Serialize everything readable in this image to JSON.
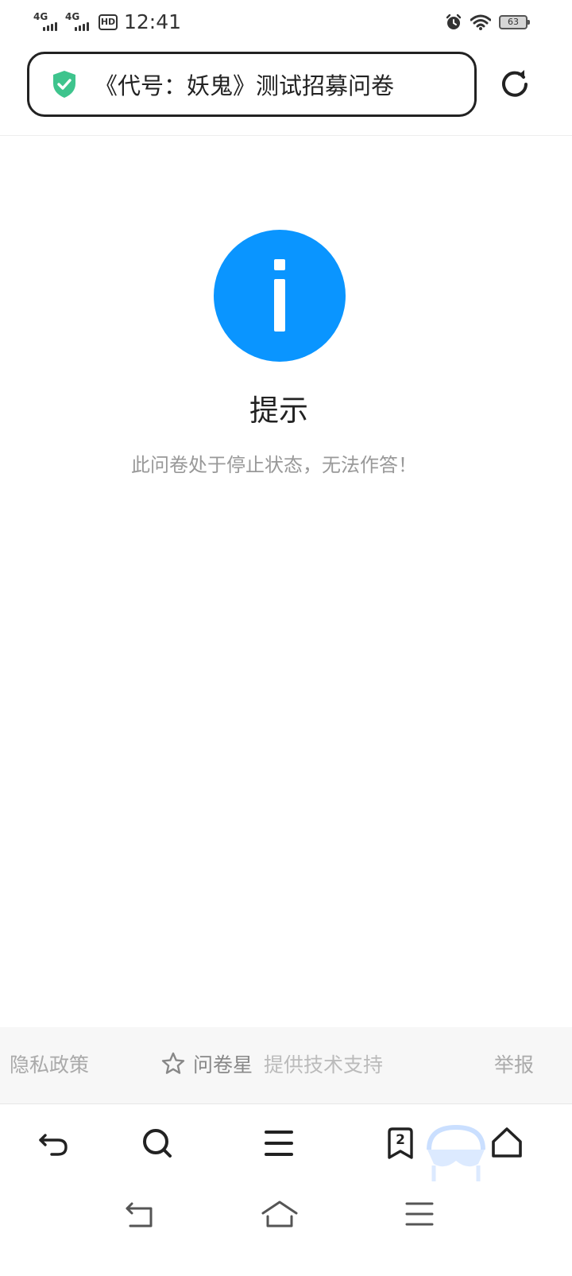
{
  "status_bar": {
    "network_1": "4G",
    "network_2": "4G",
    "hd_label": "HD",
    "time": "12:41",
    "battery_level": "63",
    "icons": [
      "alarm-icon",
      "wifi-icon",
      "battery-icon"
    ]
  },
  "address_bar": {
    "title": "《代号：妖鬼》测试招募问卷",
    "security_icon": "shield-check-icon",
    "reload_icon": "reload-icon"
  },
  "message": {
    "icon": "info-icon",
    "title": "提示",
    "text": "此问卷处于停止状态，无法作答！"
  },
  "footer": {
    "privacy": "隐私政策",
    "brand_name": "问卷星",
    "brand_support": "提供技术支持",
    "report": "举报"
  },
  "toolbar": {
    "tab_count": "2",
    "icons": [
      "back-icon",
      "search-icon",
      "menu-icon",
      "tabs-icon",
      "home-icon"
    ]
  },
  "system_nav": {
    "icons": [
      "system-back-icon",
      "system-home-icon",
      "system-menu-icon"
    ]
  },
  "colors": {
    "accent": "#0a95ff",
    "shield": "#3ec48d",
    "text_primary": "#222222",
    "text_muted": "#999999",
    "footer_bg": "#f7f7f7"
  }
}
